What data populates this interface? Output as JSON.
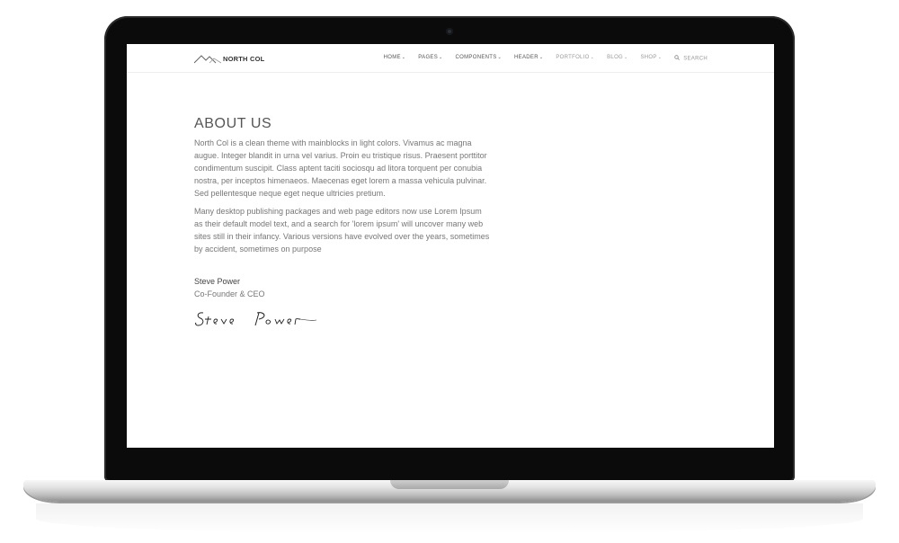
{
  "brand": {
    "name": "NORTH COL"
  },
  "nav": {
    "items": [
      {
        "label": "HOME",
        "caret": "⌄"
      },
      {
        "label": "PAGES",
        "caret": "⌄"
      },
      {
        "label": "COMPONENTS",
        "caret": "⌄"
      },
      {
        "label": "HEADER",
        "caret": "⌄"
      },
      {
        "label": "PORTFOLIO",
        "caret": "⌄"
      },
      {
        "label": "BLOG",
        "caret": "⌄"
      },
      {
        "label": "SHOP",
        "caret": "⌄"
      }
    ],
    "search_label": "SEARCH"
  },
  "about": {
    "title": "ABOUT US",
    "paragraph1": "North Col is a clean theme with mainblocks in light colors. Vivamus ac magna augue. Integer blandit in urna vel varius. Proin eu tristique risus. Praesent porttitor condimentum suscipit. Class aptent taciti sociosqu ad litora torquent per conubia nostra, per inceptos himenaeos. Maecenas eget lorem a massa vehicula pulvinar. Sed pellentesque neque eget neque ultricies pretium.",
    "paragraph2": "Many desktop publishing packages and web page editors now use Lorem Ipsum as their default model text, and a search for 'lorem ipsum' will uncover many web sites still in their infancy. Various versions have evolved over the years, sometimes by accident, sometimes on purpose",
    "author_name": "Steve Power",
    "author_role": "Co-Founder & CEO",
    "signature_text": "Steve Power"
  },
  "icons": {
    "logo": "mountain-logo-icon",
    "search": "search-icon",
    "caret": "chevron-down-icon",
    "camera": "camera-icon"
  }
}
